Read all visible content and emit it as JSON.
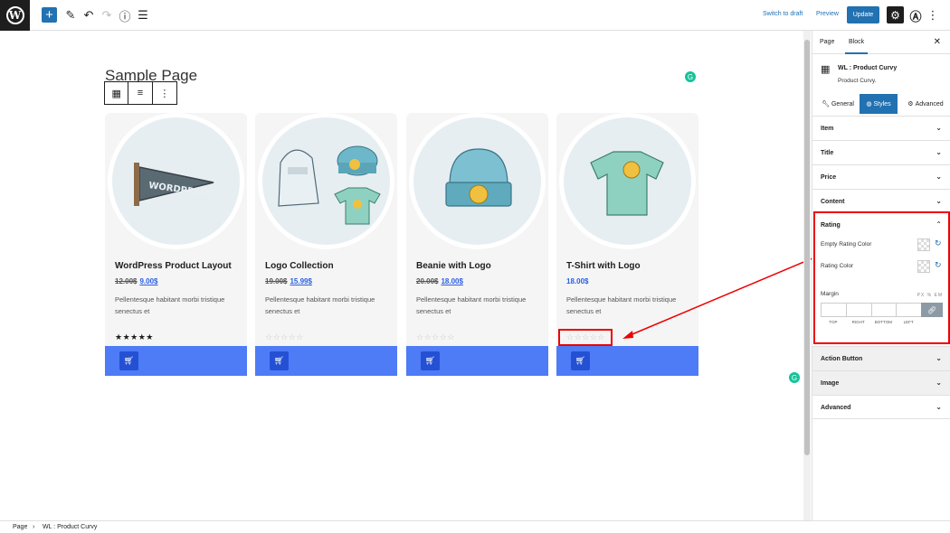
{
  "toolbar": {
    "add_icon": "+",
    "switch_to_draft": "Switch to draft",
    "preview": "Preview",
    "update": "Update"
  },
  "editor": {
    "page_title": "Sample Page"
  },
  "products": [
    {
      "title": "WordPress Product Layout",
      "old_price": "12.00$",
      "new_price": "9.00$",
      "description": "Pellentesque habitant morbi tristique senectus et",
      "rating": 5
    },
    {
      "title": "Logo Collection",
      "old_price": "19.00$",
      "new_price": "15.99$",
      "description": "Pellentesque habitant morbi tristique senectus et",
      "rating": 0
    },
    {
      "title": "Beanie with Logo",
      "old_price": "20.00$",
      "new_price": "18.00$",
      "description": "Pellentesque habitant morbi tristique senectus et",
      "rating": 0
    },
    {
      "title": "T-Shirt with Logo",
      "old_price": "",
      "new_price": "18.00$",
      "description": "Pellentesque habitant morbi tristique senectus et",
      "rating": 0
    }
  ],
  "sidebar": {
    "tabs": [
      "Page",
      "Block"
    ],
    "active_tab": "Block",
    "block_name": "WL : Product Curvy",
    "block_desc": "Product Curvy.",
    "subtabs": [
      "General",
      "Styles",
      "Advanced"
    ],
    "active_subtab": "Styles",
    "panels_top": [
      "Item",
      "Title",
      "Price",
      "Content"
    ],
    "rating_panel": {
      "label": "Rating",
      "empty_color_label": "Empty Rating Color",
      "color_label": "Rating Color",
      "margin_label": "Margin",
      "units": "PX % EM",
      "sides": [
        "TOP",
        "RIGHT",
        "BOTTOM",
        "LEFT"
      ]
    },
    "panels_bottom": [
      "Action Button",
      "Image",
      "Advanced"
    ]
  },
  "breadcrumb": {
    "root": "Page",
    "separator": "›",
    "current": "WL : Product Curvy"
  },
  "colors": {
    "accent": "#2271b1",
    "action_bar": "#4e7bf6",
    "cart_button": "#2450d4",
    "price": "#2a5ee0",
    "highlight": "#e00000"
  }
}
